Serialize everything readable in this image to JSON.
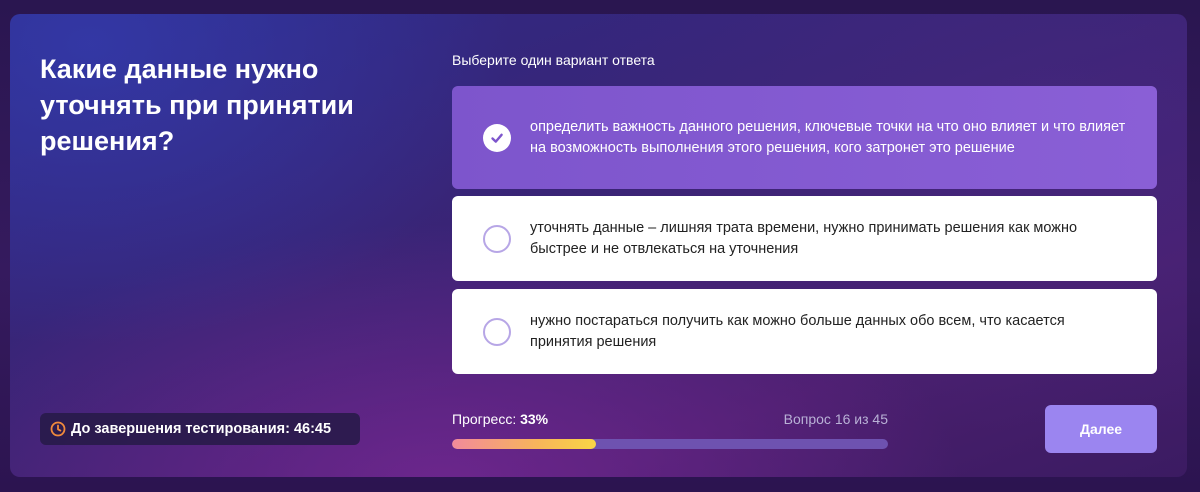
{
  "question": {
    "title": "Какие данные нужно уточнять при принятии решения?"
  },
  "answers": {
    "instruction": "Выберите один вариант ответа",
    "options": [
      {
        "text": "определить важность данного решения, ключевые точки на что оно влияет и что влияет на возможность выполнения этого решения, кого затронет это решение",
        "selected": true
      },
      {
        "text": "уточнять данные – лишняя трата времени, нужно принимать решения как можно быстрее и не отвлекаться на уточнения",
        "selected": false
      },
      {
        "text": "нужно постараться получить как можно больше данных обо всем, что касается принятия решения",
        "selected": false
      }
    ]
  },
  "timer": {
    "icon": "clock-icon",
    "label": "До завершения тестирования: 46:45",
    "color": "#f08a3c"
  },
  "progress": {
    "label": "Прогресс:",
    "value_text": "33%",
    "percent": 33,
    "counter": "Вопрос 16 из 45"
  },
  "navigation": {
    "next_label": "Далее"
  },
  "colors": {
    "accent": "#9b85f0",
    "selected_option": "#7d55cc",
    "radio_border": "#b7a6e6"
  }
}
